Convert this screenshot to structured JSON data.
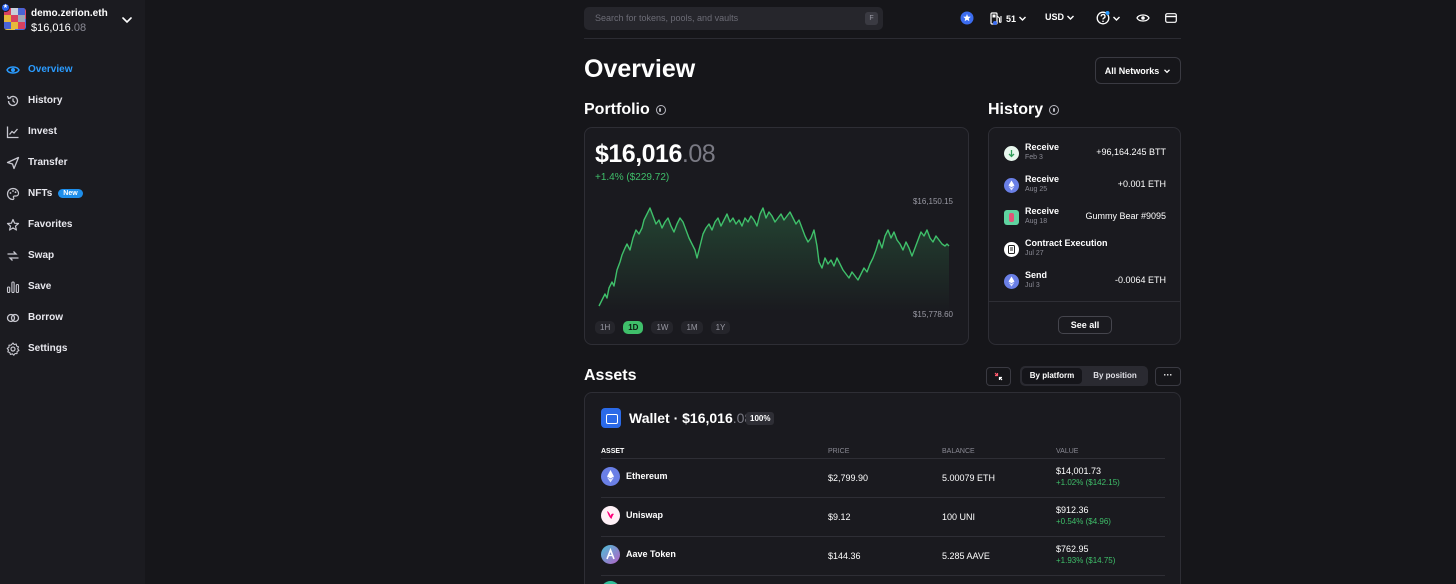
{
  "account": {
    "name": "demo.zerion.eth",
    "balance_main": "$16,016",
    "balance_cents": ".08"
  },
  "sidebar": {
    "items": [
      {
        "label": "Overview",
        "icon": "eye-icon",
        "active": true
      },
      {
        "label": "History",
        "icon": "history-icon"
      },
      {
        "label": "Invest",
        "icon": "chart-line-icon"
      },
      {
        "label": "Transfer",
        "icon": "send-icon"
      },
      {
        "label": "NFTs",
        "icon": "palette-icon",
        "badge": "New"
      },
      {
        "label": "Favorites",
        "icon": "star-icon"
      },
      {
        "label": "Swap",
        "icon": "swap-icon"
      },
      {
        "label": "Save",
        "icon": "bar-chart-icon"
      },
      {
        "label": "Borrow",
        "icon": "borrow-icon"
      },
      {
        "label": "Settings",
        "icon": "gear-icon"
      }
    ]
  },
  "topbar": {
    "search_placeholder": "Search for tokens, pools, and vaults",
    "search_shortcut": "F",
    "gas_value": "51",
    "currency": "USD"
  },
  "page": {
    "title": "Overview",
    "networks_label": "All Networks"
  },
  "portfolio": {
    "title": "Portfolio",
    "value_main": "$16,016",
    "value_cents": ".08",
    "change": "+1.4% ($229.72)",
    "chart_high": "$16,150.15",
    "chart_low": "$15,778.60",
    "ranges": [
      "1H",
      "1D",
      "1W",
      "1M",
      "1Y"
    ],
    "active_range": "1D",
    "accent_color": "#3fbf6a"
  },
  "history": {
    "title": "History",
    "items": [
      {
        "type": "Receive",
        "date": "Feb 3",
        "amount": "+96,164.245 BTT",
        "icon": "arrow-down-icon"
      },
      {
        "type": "Receive",
        "date": "Aug 25",
        "amount": "+0.001 ETH",
        "icon": "ethereum-icon"
      },
      {
        "type": "Receive",
        "date": "Aug 18",
        "amount": "Gummy Bear #9095",
        "icon": "nft-thumbnail-icon"
      },
      {
        "type": "Contract Execution",
        "date": "Jul 27",
        "amount": "",
        "icon": "contract-icon"
      },
      {
        "type": "Send",
        "date": "Jul 3",
        "amount": "-0.0064 ETH",
        "icon": "ethereum-icon"
      }
    ],
    "see_all": "See all"
  },
  "assets": {
    "title": "Assets",
    "segment": [
      "By platform",
      "By position"
    ],
    "more_label": "···",
    "wallet_title_main": "Wallet · $16,016",
    "wallet_title_cents": ".08",
    "wallet_pct": "100%",
    "columns": [
      "ASSET",
      "PRICE",
      "BALANCE",
      "VALUE"
    ],
    "rows": [
      {
        "name": "Ethereum",
        "price": "$2,799.90",
        "balance": "5.00079 ETH",
        "value": "$14,001.73",
        "change": "+1.02% ($142.15)"
      },
      {
        "name": "Uniswap",
        "price": "$9.12",
        "balance": "100 UNI",
        "value": "$912.36",
        "change": "+0.54% ($4.96)"
      },
      {
        "name": "Aave Token",
        "price": "$144.36",
        "balance": "5.285 AAVE",
        "value": "$762.95",
        "change": "+1.93% ($14.75)"
      }
    ]
  }
}
